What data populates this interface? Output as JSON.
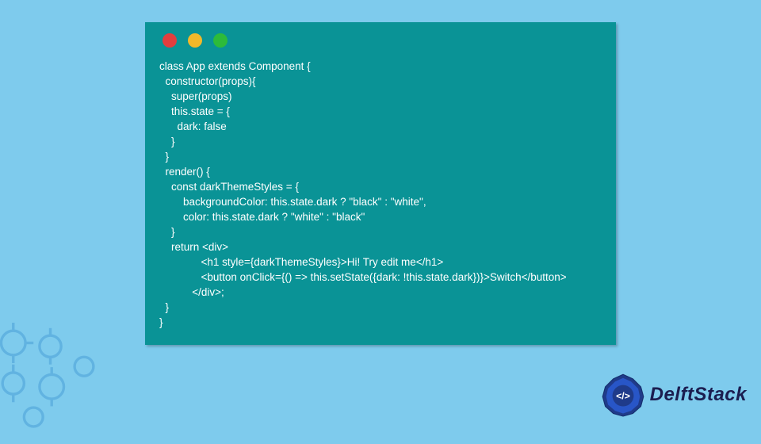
{
  "code": {
    "lines": [
      "class App extends Component {",
      "  constructor(props){",
      "    super(props)",
      "    this.state = {",
      "      dark: false",
      "    }",
      "  }",
      "  render() {",
      "    const darkThemeStyles = {",
      "        backgroundColor: this.state.dark ? \"black\" : \"white\",",
      "        color: this.state.dark ? \"white\" : \"black\"",
      "    }",
      "    return <div>",
      "              <h1 style={darkThemeStyles}>Hi! Try edit me</h1>",
      "              <button onClick={() => this.setState({dark: !this.state.dark})}>Switch</button>",
      "           </div>;",
      "  }",
      "}"
    ]
  },
  "brand": {
    "name": "DelftStack"
  },
  "colors": {
    "page_bg": "#7ecbed",
    "window_bg": "#0a9396",
    "red": "#e23e3e",
    "yellow": "#f2b82a",
    "green": "#2dbb3a",
    "brand_text": "#1b1d50"
  }
}
